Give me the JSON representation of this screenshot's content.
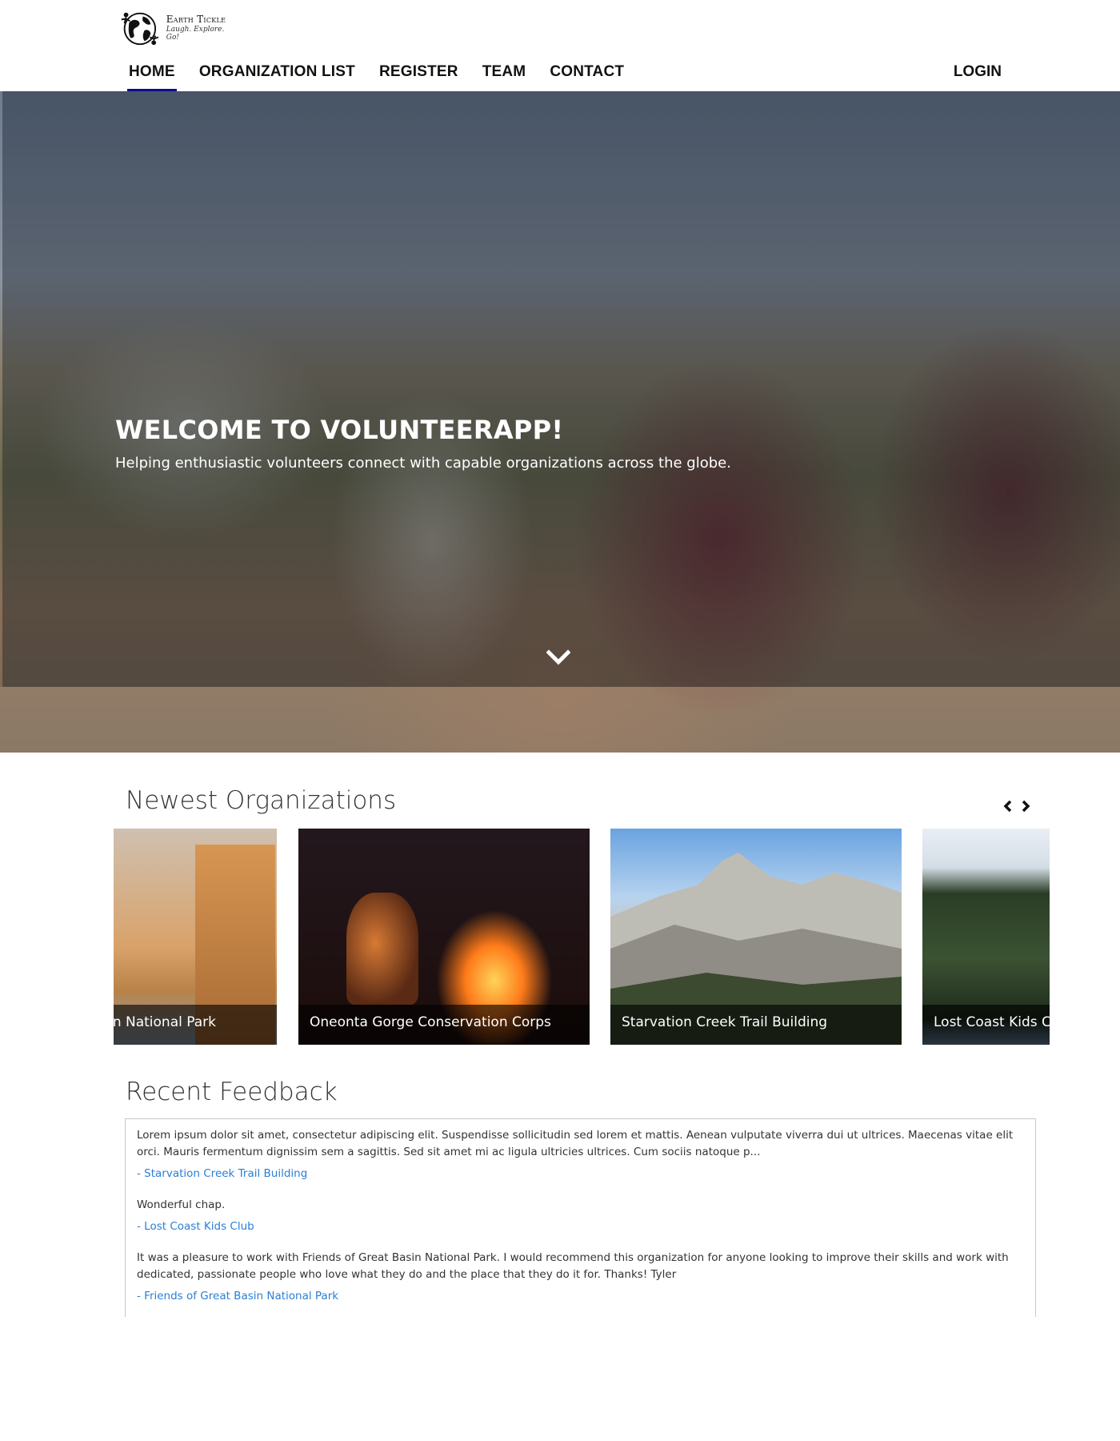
{
  "brand": {
    "name": "Earth Tickle",
    "tagline": "Laugh. Explore. Go!"
  },
  "nav": {
    "items": [
      {
        "label": "HOME",
        "active": true
      },
      {
        "label": "ORGANIZATION LIST",
        "active": false
      },
      {
        "label": "REGISTER",
        "active": false
      },
      {
        "label": "TEAM",
        "active": false
      },
      {
        "label": "CONTACT",
        "active": false
      }
    ],
    "login": "LOGIN",
    "active_color": "#0d0d8a"
  },
  "hero": {
    "title": "WELCOME TO VOLUNTEERAPP!",
    "subtitle": "Helping enthusiastic volunteers connect with capable organizations across the globe.",
    "scroll_icon": "chevron-down-icon"
  },
  "organizations": {
    "title": "Newest Organizations",
    "prev_icon": "chevron-left-icon",
    "next_icon": "chevron-right-icon",
    "cards": [
      {
        "name": "asin National Park"
      },
      {
        "name": "Oneonta Gorge Conservation Corps"
      },
      {
        "name": "Starvation Creek Trail Building"
      },
      {
        "name": "Lost Coast Kids Club"
      }
    ]
  },
  "feedback": {
    "title": "Recent Feedback",
    "link_color": "#2a7fd4",
    "items": [
      {
        "text": "Lorem ipsum dolor sit amet, consectetur adipiscing elit. Suspendisse sollicitudin sed lorem et mattis. Aenean vulputate viverra dui ut ultrices. Maecenas vitae elit orci. Mauris fermentum dignissim sem a sagittis. Sed sit amet mi ac ligula ultricies ultrices. Cum sociis natoque p...",
        "org": "- Starvation Creek Trail Building"
      },
      {
        "text": "Wonderful chap.",
        "org": "- Lost Coast Kids Club"
      },
      {
        "text": "It was a pleasure to work with Friends of Great Basin National Park. I would recommend this organization for anyone looking to improve their skills and work with dedicated, passionate people who love what they do and the place that they do it for. Thanks! Tyler",
        "org": "- Friends of Great Basin National Park"
      }
    ]
  }
}
